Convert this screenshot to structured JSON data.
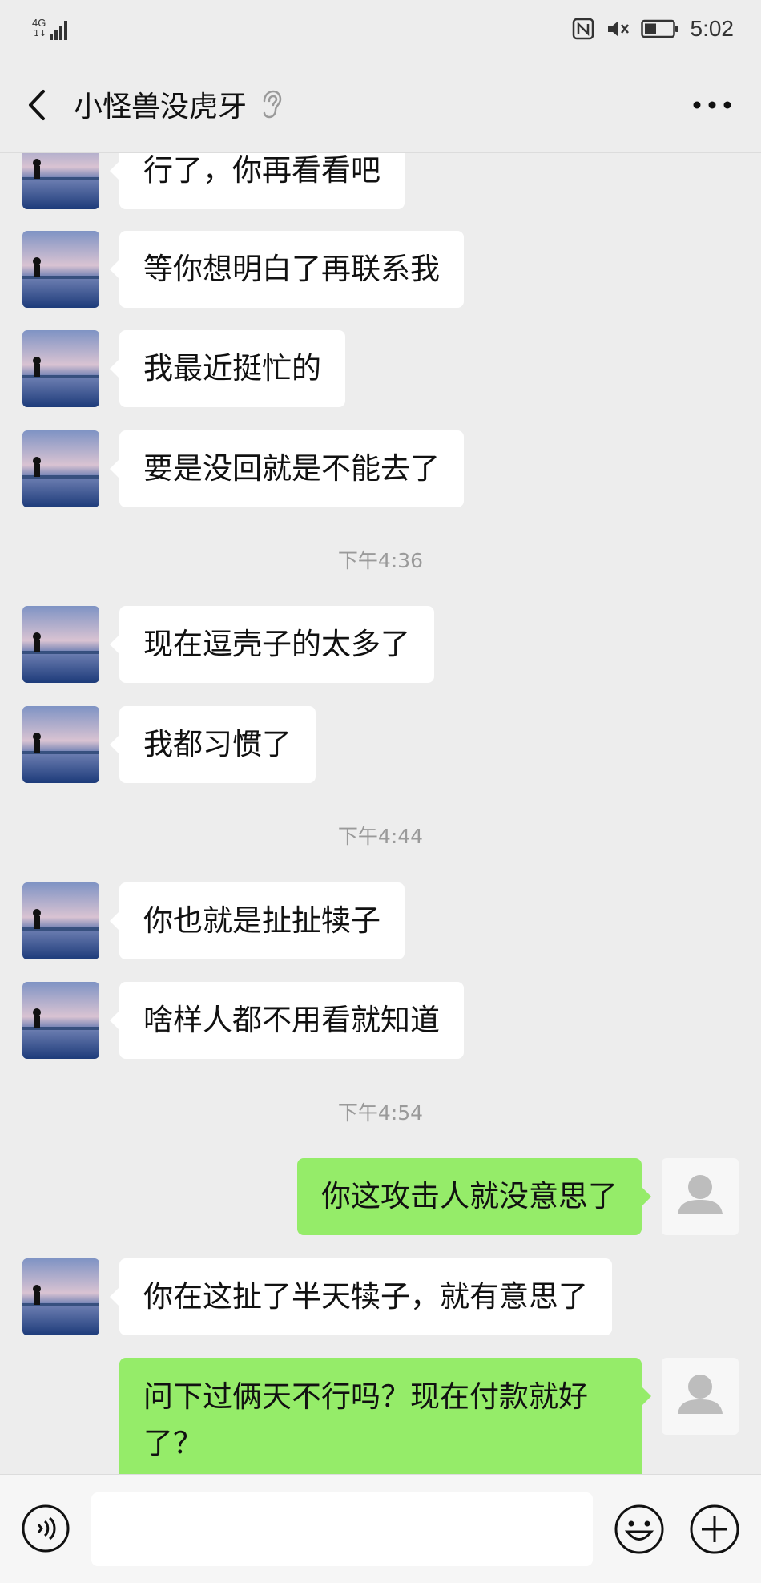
{
  "status_bar": {
    "network": "4G",
    "network_sub": "1↓",
    "time": "5:02",
    "icons": [
      "nfc-icon",
      "mute-icon",
      "battery-icon"
    ]
  },
  "header": {
    "back_icon": "chevron-left-icon",
    "title": "小怪兽没虎牙",
    "title_icon": "ear-icon",
    "more_icon": "more-dots-icon"
  },
  "messages": [
    {
      "type": "text",
      "from": "them",
      "text": "行了，你再看看吧"
    },
    {
      "type": "text",
      "from": "them",
      "text": "等你想明白了再联系我"
    },
    {
      "type": "text",
      "from": "them",
      "text": "我最近挺忙的"
    },
    {
      "type": "text",
      "from": "them",
      "text": "要是没回就是不能去了"
    },
    {
      "type": "time",
      "text": "下午4:36"
    },
    {
      "type": "text",
      "from": "them",
      "text": "现在逗壳子的太多了"
    },
    {
      "type": "text",
      "from": "them",
      "text": "我都习惯了"
    },
    {
      "type": "time",
      "text": "下午4:44"
    },
    {
      "type": "text",
      "from": "them",
      "text": "你也就是扯扯犊子"
    },
    {
      "type": "text",
      "from": "them",
      "text": "啥样人都不用看就知道"
    },
    {
      "type": "time",
      "text": "下午4:54"
    },
    {
      "type": "text",
      "from": "me",
      "text": "你这攻击人就没意思了"
    },
    {
      "type": "text",
      "from": "them",
      "text": "你在这扯了半天犊子，就有意思了"
    },
    {
      "type": "text",
      "from": "me",
      "text": "问下过俩天不行吗？现在付款就好了？"
    }
  ],
  "bottom_bar": {
    "voice_icon": "voice-icon",
    "input_value": "",
    "emoji_icon": "emoji-icon",
    "plus_icon": "plus-circle-icon"
  },
  "colors": {
    "background": "#ededed",
    "my_bubble": "#95ec69",
    "their_bubble": "#ffffff",
    "timestamp": "#9a9a9a"
  }
}
